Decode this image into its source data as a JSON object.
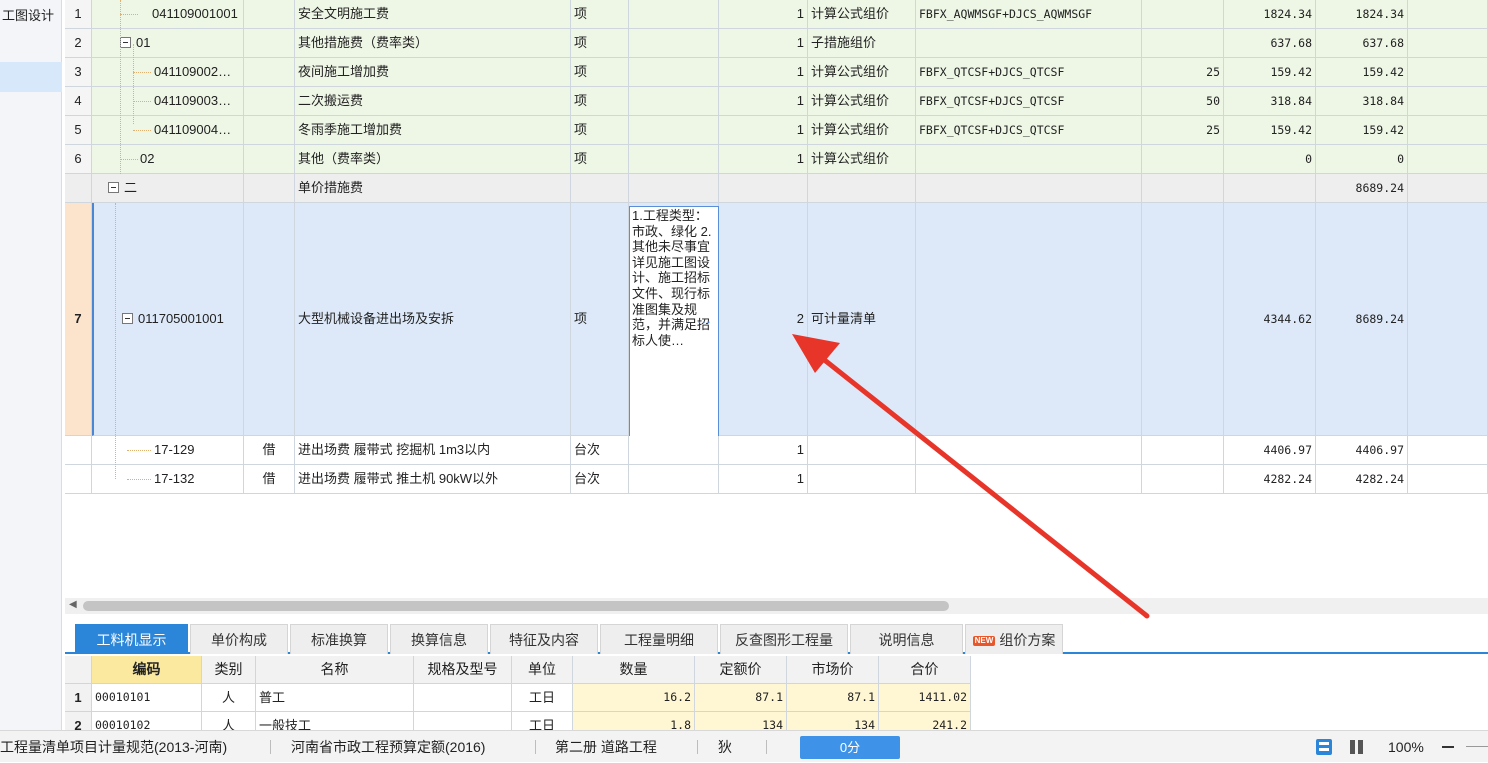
{
  "sidebar": {
    "items": [
      {
        "label": "工图设计"
      },
      {
        "label": ""
      }
    ]
  },
  "grid": {
    "rows": [
      {
        "num": "1",
        "code": "041109001001",
        "cat": "",
        "name": "安全文明施工费",
        "unit": "项",
        "feature": "",
        "qty": "1",
        "type": "计算公式组价",
        "formula": "FBFX_AQWMSGF+DJCS_AQWMSGF",
        "rate": "",
        "price": "1824.34",
        "total": "1824.34"
      },
      {
        "num": "2",
        "code": "01",
        "cat": "",
        "name": "其他措施费（费率类）",
        "unit": "项",
        "feature": "",
        "qty": "1",
        "type": "子措施组价",
        "formula": "",
        "rate": "",
        "price": "637.68",
        "total": "637.68"
      },
      {
        "num": "3",
        "code": "041109002…",
        "cat": "",
        "name": "夜间施工增加费",
        "unit": "项",
        "feature": "",
        "qty": "1",
        "type": "计算公式组价",
        "formula": "FBFX_QTCSF+DJCS_QTCSF",
        "rate": "25",
        "price": "159.42",
        "total": "159.42"
      },
      {
        "num": "4",
        "code": "041109003…",
        "cat": "",
        "name": "二次搬运费",
        "unit": "项",
        "feature": "",
        "qty": "1",
        "type": "计算公式组价",
        "formula": "FBFX_QTCSF+DJCS_QTCSF",
        "rate": "50",
        "price": "318.84",
        "total": "318.84"
      },
      {
        "num": "5",
        "code": "041109004…",
        "cat": "",
        "name": "冬雨季施工增加费",
        "unit": "项",
        "feature": "",
        "qty": "1",
        "type": "计算公式组价",
        "formula": "FBFX_QTCSF+DJCS_QTCSF",
        "rate": "25",
        "price": "159.42",
        "total": "159.42"
      },
      {
        "num": "6",
        "code": "02",
        "cat": "",
        "name": "其他（费率类）",
        "unit": "项",
        "feature": "",
        "qty": "1",
        "type": "计算公式组价",
        "formula": "",
        "rate": "",
        "price": "0",
        "total": "0"
      },
      {
        "num": "",
        "code": "二",
        "cat": "",
        "name": "单价措施费",
        "unit": "",
        "feature": "",
        "qty": "",
        "type": "",
        "formula": "",
        "rate": "",
        "price": "",
        "total": "8689.24"
      },
      {
        "num": "7",
        "code": "011705001001",
        "cat": "",
        "name": "大型机械设备进出场及安拆",
        "unit": "项",
        "feature": "1.工程类型：市政、绿化 2.其他未尽事宜详见施工图设计、施工招标文件、现行标准图集及规范，并满足招标人使…",
        "feature_more": "···",
        "qty": "2",
        "type": "可计量清单",
        "formula": "",
        "rate": "",
        "price": "4344.62",
        "total": "8689.24"
      },
      {
        "num": "",
        "code": "17-129",
        "cat": "借",
        "name": "进出场费 履带式 挖掘机 1m3以内",
        "unit": "台次",
        "feature": "",
        "qty": "1",
        "type": "",
        "formula": "",
        "rate": "",
        "price": "4406.97",
        "total": "4406.97"
      },
      {
        "num": "",
        "code": "17-132",
        "cat": "借",
        "name": "进出场费 履带式 推土机 90kW以外",
        "unit": "台次",
        "feature": "",
        "qty": "1",
        "type": "",
        "formula": "",
        "rate": "",
        "price": "4282.24",
        "total": "4282.24"
      }
    ]
  },
  "tabs": [
    {
      "label": "工料机显示"
    },
    {
      "label": "单价构成"
    },
    {
      "label": "标准换算"
    },
    {
      "label": "换算信息"
    },
    {
      "label": "特征及内容"
    },
    {
      "label": "工程量明细"
    },
    {
      "label": "反查图形工程量"
    },
    {
      "label": "说明信息"
    },
    {
      "label": "组价方案",
      "badge": "NEW"
    }
  ],
  "subgrid": {
    "headers": [
      "编码",
      "类别",
      "名称",
      "规格及型号",
      "单位",
      "数量",
      "定额价",
      "市场价",
      "合价"
    ],
    "rows": [
      {
        "num": "1",
        "code": "00010101",
        "cat": "人",
        "name": "普工",
        "spec": "",
        "unit": "工日",
        "qty": "16.2",
        "quota": "87.1",
        "market": "87.1",
        "total": "1411.02"
      },
      {
        "num": "2",
        "code": "00010102",
        "cat": "人",
        "name": "一般技工",
        "spec": "",
        "unit": "工日",
        "qty": "1.8",
        "quota": "134",
        "market": "134",
        "total": "241.2"
      }
    ]
  },
  "status": {
    "item1": "工程量清单项目计量规范(2013-河南)",
    "item2": "河南省市政工程预算定额(2016)",
    "item3": "第二册 道路工程",
    "item4": "狄",
    "score": "0分",
    "zoom": "100%"
  },
  "colors": {
    "accent": "#2b86d9",
    "arrow": "#e8352a",
    "green_row": "#eef7e6",
    "selected_row": "#dde9f9"
  }
}
